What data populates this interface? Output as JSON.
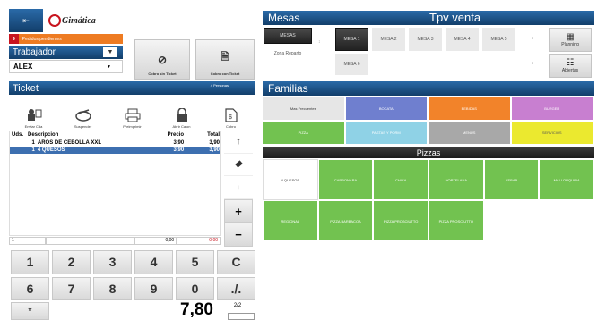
{
  "header": {
    "back_icon": "back-arrow-icon",
    "logo_text": "Gimática",
    "pending_count": "9",
    "pending_label": "Pedidos pendientes",
    "worker_label": "Trabajador",
    "worker_value": "ALEX",
    "cobro_sin_ticket": "Cobro sin Ticket",
    "cobro_con_ticket": "Cobro con Ticket"
  },
  "ticket": {
    "title": "Ticket",
    "people": "4 Personas",
    "tools": [
      {
        "label": "Enviar Cda",
        "icon": "send-kitchen-icon"
      },
      {
        "label": "Suspender",
        "icon": "suspend-icon"
      },
      {
        "label": "Preimprimir",
        "icon": "printer-icon"
      },
      {
        "label": "Abrir Cajon",
        "icon": "lock-icon"
      },
      {
        "label": "Cobro",
        "icon": "document-icon"
      }
    ],
    "columns": {
      "uds": "Uds.",
      "desc": "Descripcion",
      "precio": "Precio",
      "total": "Total"
    },
    "lines": [
      {
        "uds": "1",
        "desc": "AROS DE CEBOLLA XXL",
        "precio": "3,90",
        "total": "3,90"
      },
      {
        "uds": "1",
        "desc": "4 QUESOS",
        "precio": "3,90",
        "total": "3,90"
      }
    ],
    "input_qty": "1",
    "input_price": "0,00",
    "input_total": "0,00"
  },
  "keypad": {
    "keys": [
      "1",
      "2",
      "3",
      "4",
      "5",
      "C",
      "6",
      "7",
      "8",
      "9",
      "0",
      "./."
    ],
    "multiply": "*",
    "total": "7,80",
    "page": "2/2"
  },
  "mesas": {
    "title": "Mesas",
    "venta_title": "Tpv venta",
    "zone_selected": "MESAS",
    "zone_other": "Zona Reparto",
    "tables": [
      "MESA 1",
      "MESA 2",
      "MESA 3",
      "MESA 4",
      "MESA 5",
      "MESA 6"
    ],
    "planning": "Planning",
    "abiertas": "Abiertas"
  },
  "familias": {
    "title": "Familias",
    "items": [
      {
        "label": "Mas Frecuentes",
        "color": "#e6e6e6"
      },
      {
        "label": "BOCATA",
        "color": "#6f7fcf"
      },
      {
        "label": "BEBIDAS",
        "color": "#f2832a"
      },
      {
        "label": "BURGER",
        "color": "#c87fd0"
      },
      {
        "label": "PIZZA",
        "color": "#72c250"
      },
      {
        "label": "PASTAS Y PORM",
        "color": "#8fd2e6"
      },
      {
        "label": "MENUS",
        "color": "#a8a8a8"
      },
      {
        "label": "SERVICIOS",
        "color": "#ebe92f"
      }
    ]
  },
  "pizzas": {
    "title": "Pizzas",
    "items": [
      "4 QUESOS",
      "CARBONARA",
      "CHICA",
      "HORTELANA",
      "KEBAB",
      "MALLORQUINA",
      "REGIONAL",
      "PIZZA BARBACOA",
      "PIZZA PROSCIUTTO",
      "PIZZA PROSCIUTTO"
    ]
  }
}
